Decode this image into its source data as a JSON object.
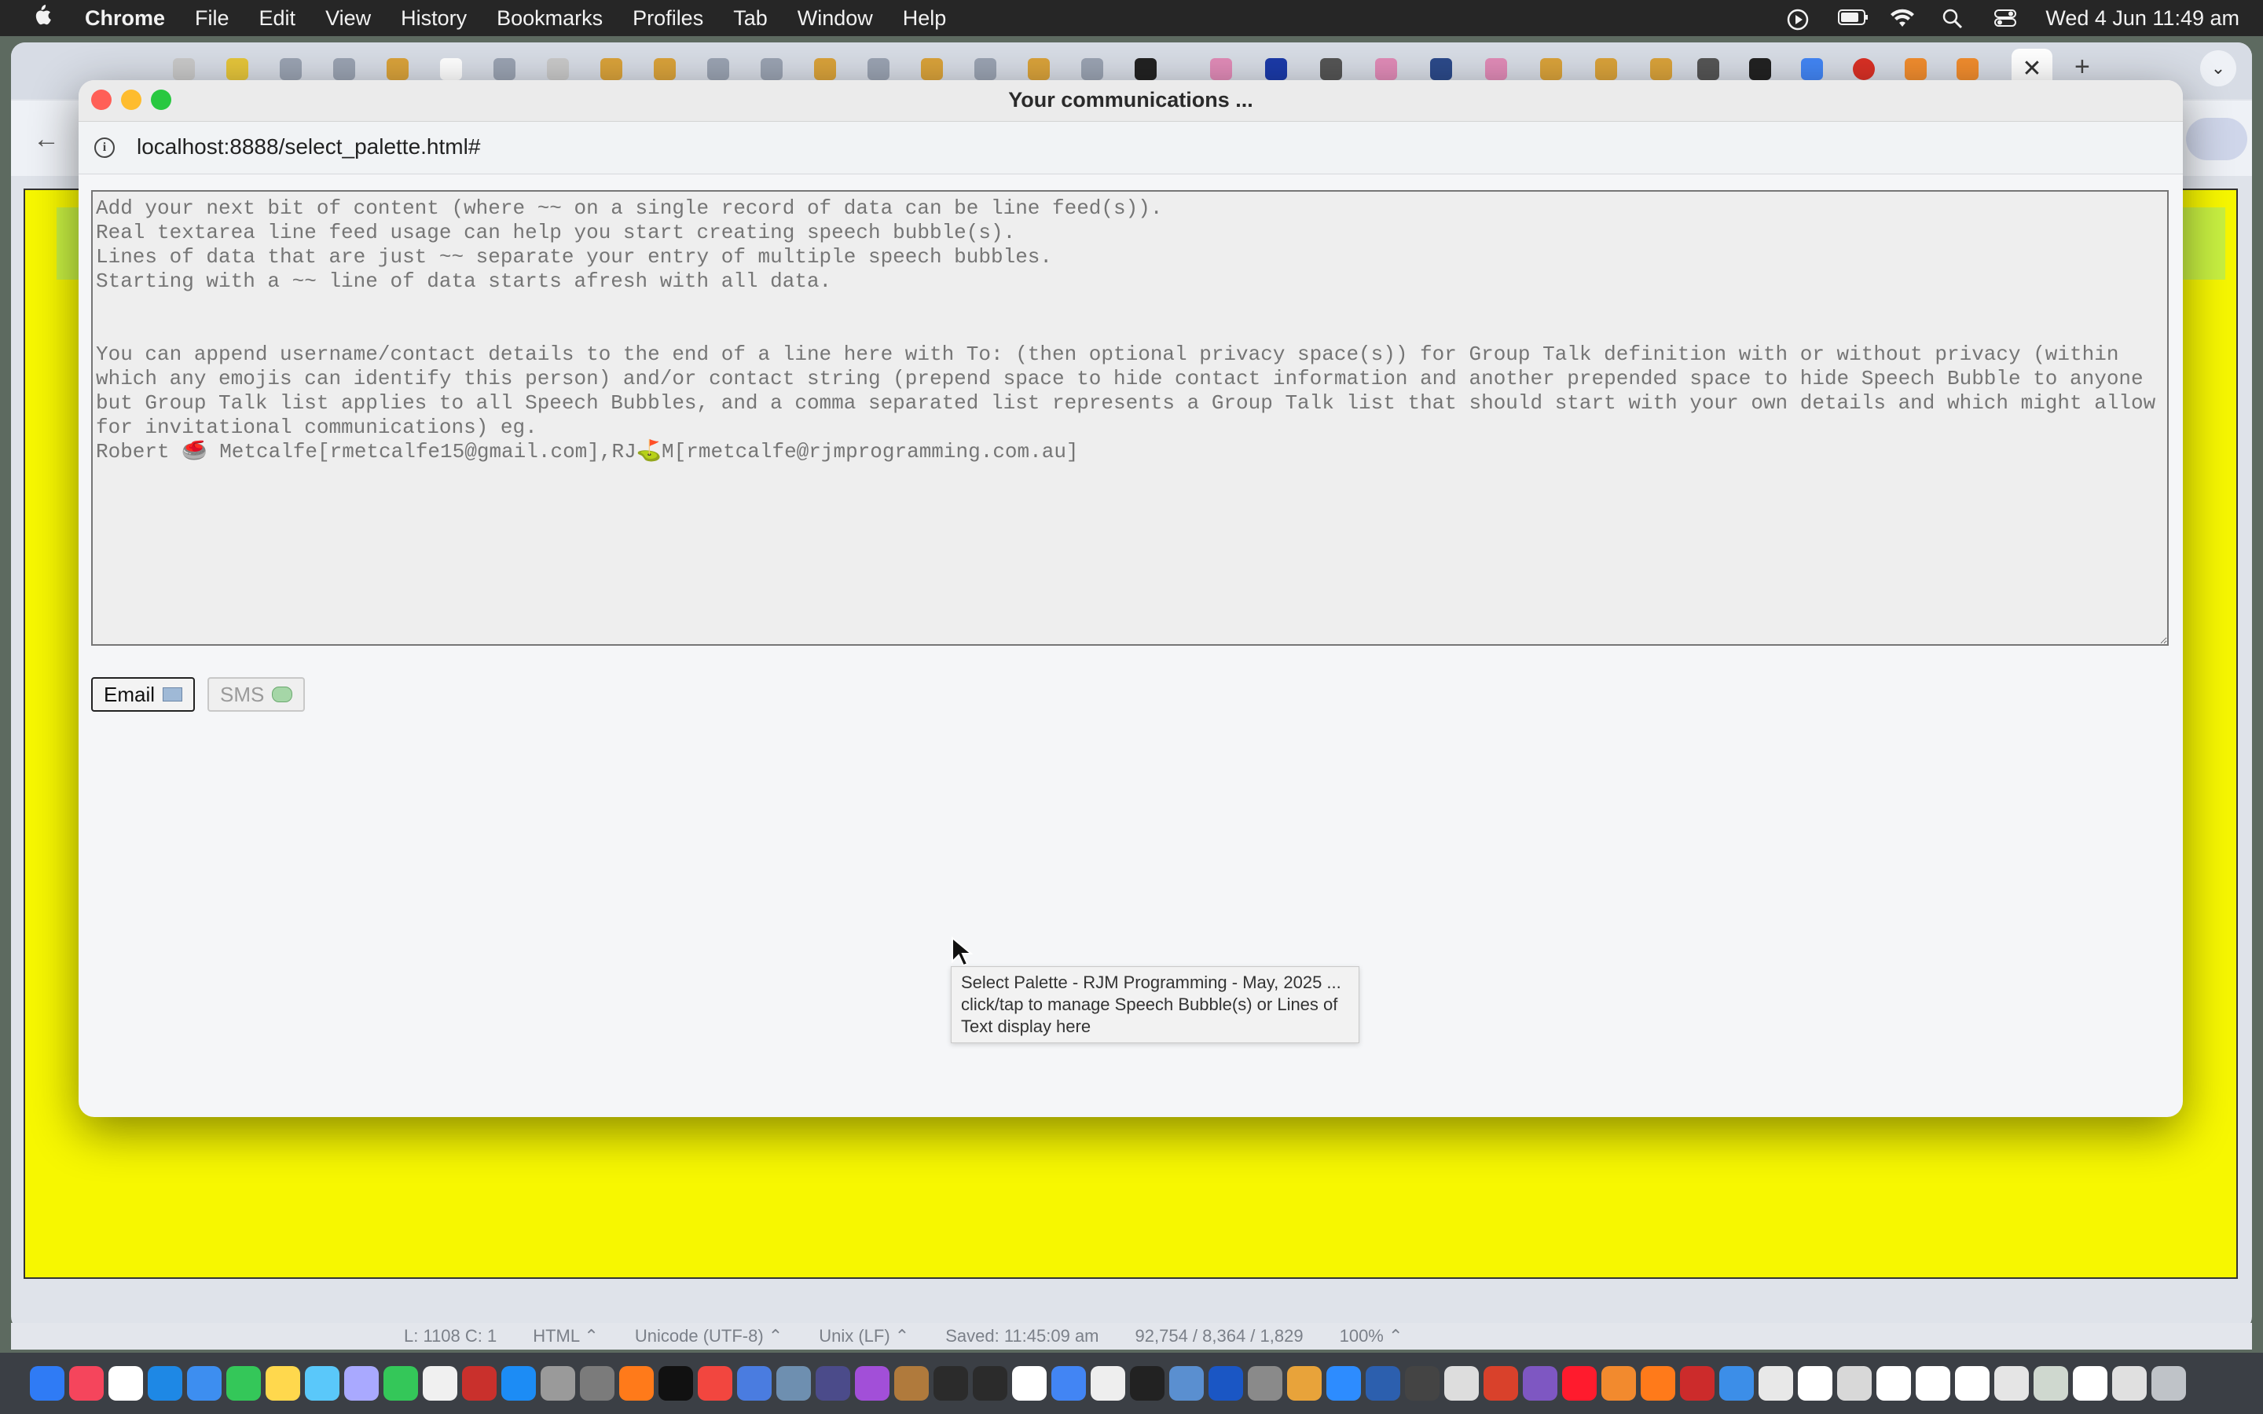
{
  "menubar": {
    "app_name": "Chrome",
    "items": [
      "File",
      "Edit",
      "View",
      "History",
      "Bookmarks",
      "Profiles",
      "Tab",
      "Window",
      "Help"
    ],
    "clock": "Wed 4 Jun  11:49 am"
  },
  "popup": {
    "title": "Your communications ...",
    "url": "localhost:8888/select_palette.html#",
    "textarea_placeholder": "Add your next bit of content (where ~~ on a single record of data can be line feed(s)).\nReal textarea line feed usage can help you start creating speech bubble(s).\nLines of data that are just ~~ separate your entry of multiple speech bubbles.\nStarting with a ~~ line of data starts afresh with all data.\n\n\nYou can append username/contact details to the end of a line here with To: (then optional privacy space(s)) for Group Talk definition with or without privacy (within which any emojis can identify this person) and/or contact string (prepend space to hide contact information and another prepended space to hide Speech Bubble to anyone but Group Talk list applies to all Speech Bubbles, and a comma separated list represents a Group Talk list that should start with your own details and which might allow for invitational communications) eg.\nRobert 🥌 Metcalfe[rmetcalfe15@gmail.com],RJ⛳M[rmetcalfe@rjmprogramming.com.au]",
    "email_label": "Email",
    "sms_label": "SMS",
    "tooltip": "Select Palette - RJM Programming - May, 2025 ... click/tap to manage Speech Bubble(s) or Lines of Text display here"
  },
  "status_bar": {
    "position": "L: 1108 C: 1",
    "language": "HTML ⌃",
    "encoding": "Unicode (UTF-8) ⌃",
    "line_endings": "Unix (LF) ⌃",
    "saved": "Saved: 11:45:09 am",
    "counts": "92,754 / 8,364 / 1,829",
    "zoom": "100% ⌃"
  },
  "colors": {
    "page_yellow": "#f7f700",
    "close": "#ff5f57",
    "minimize": "#febc2e",
    "maximize": "#28c840"
  }
}
